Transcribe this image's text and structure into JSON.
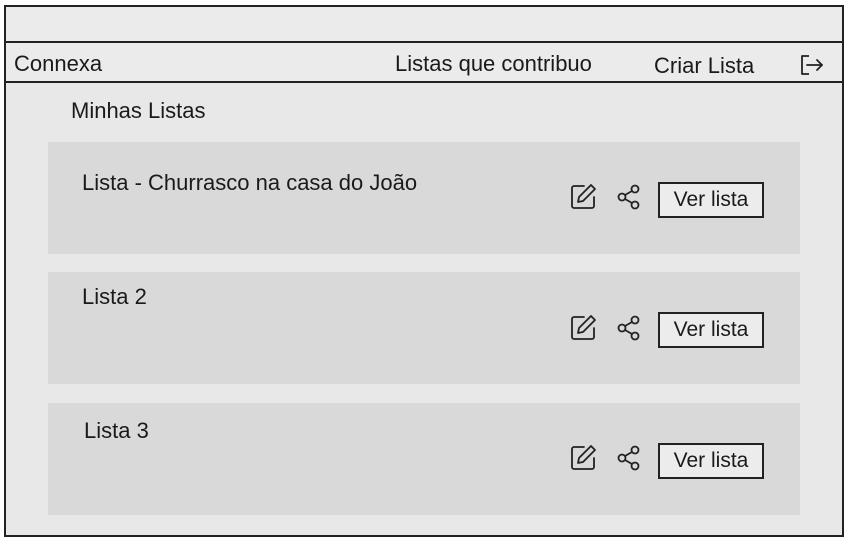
{
  "navbar": {
    "brand": "Connexa",
    "links": [
      "Listas que contribuo",
      "Criar Lista"
    ]
  },
  "main": {
    "title": "Minhas Listas",
    "lists": [
      {
        "title": "Lista - Churrasco na casa do João",
        "action_label": "Ver lista"
      },
      {
        "title": "Lista 2",
        "action_label": "Ver lista"
      },
      {
        "title": "Lista 3",
        "action_label": "Ver lista"
      }
    ]
  },
  "icons": {
    "logout": "logout-icon",
    "edit": "edit-icon",
    "share": "share-icon"
  }
}
